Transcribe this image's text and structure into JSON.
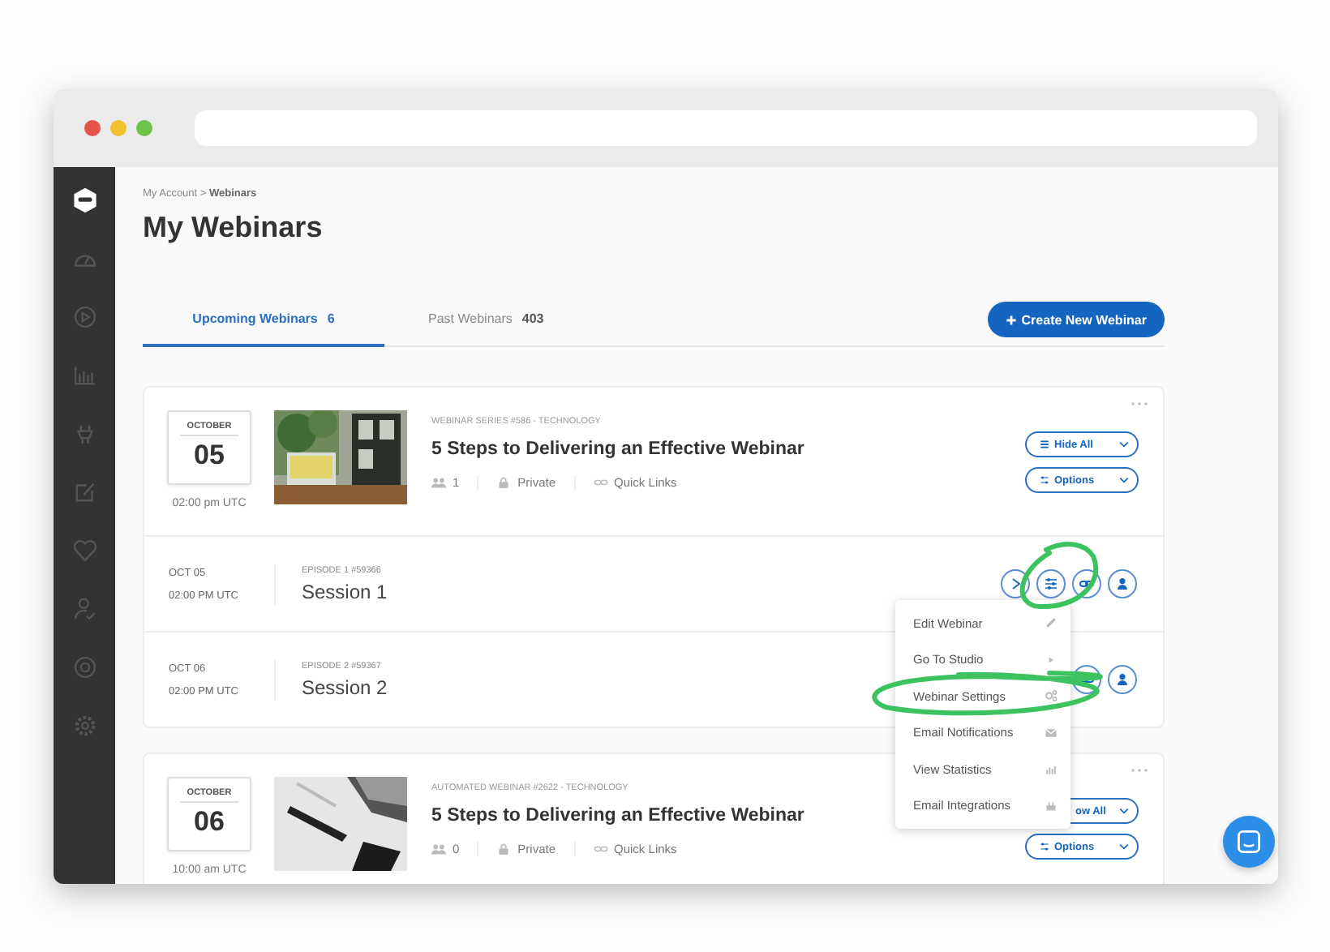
{
  "breadcrumb": "My Account > **Webinars**",
  "title": "My Webinars",
  "tabs": [
    {
      "label": "Upcoming Webinars",
      "count": "6",
      "selected": true
    },
    {
      "label": "Past Webinars",
      "count": "403",
      "selected": false
    }
  ],
  "create_button": "Create New Webinar",
  "webinars": [
    {
      "month": "OCTOBER",
      "day": "05",
      "time": "02:00 pm UTC",
      "category": "WEBINAR SERIES #586 - TECHNOLOGY",
      "title": "5 Steps to Delivering an Effective Webinar",
      "attendees": "1",
      "privacy": "Private",
      "links": "Quick Links",
      "buttons": [
        "Hide All",
        "Options"
      ],
      "sessions": [
        {
          "date": "OCT 05",
          "time": "02:00 PM UTC",
          "episode": "EPISODE 1 #59366",
          "name": "Session 1"
        },
        {
          "date": "OCT 06",
          "time": "02:00 PM UTC",
          "episode": "EPISODE 2 #59367",
          "name": "Session 2"
        }
      ]
    },
    {
      "month": "OCTOBER",
      "day": "06",
      "time": "10:00 am UTC",
      "category": "AUTOMATED WEBINAR #2622 - TECHNOLOGY",
      "title": "5 Steps to Delivering an Effective Webinar",
      "attendees": "0",
      "privacy": "Private",
      "links": "Quick Links",
      "buttons": [
        "ow All",
        "Options"
      ]
    }
  ],
  "menu": {
    "items": [
      "Edit Webinar",
      "Go To Studio",
      "Webinar Settings",
      "Email Notifications",
      "View Statistics",
      "Email Integrations"
    ]
  }
}
